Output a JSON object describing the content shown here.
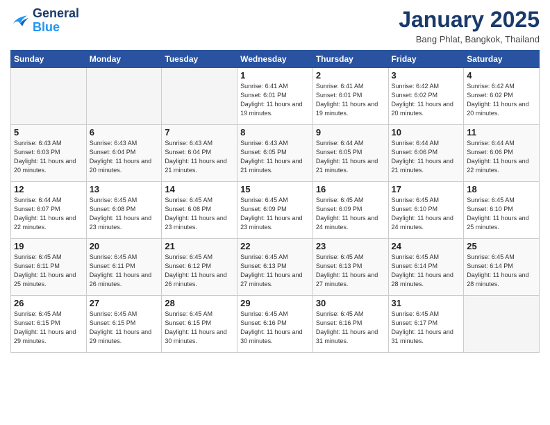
{
  "header": {
    "logo_line1": "General",
    "logo_line2": "Blue",
    "month": "January 2025",
    "location": "Bang Phlat, Bangkok, Thailand"
  },
  "days_of_week": [
    "Sunday",
    "Monday",
    "Tuesday",
    "Wednesday",
    "Thursday",
    "Friday",
    "Saturday"
  ],
  "weeks": [
    [
      {
        "num": "",
        "info": ""
      },
      {
        "num": "",
        "info": ""
      },
      {
        "num": "",
        "info": ""
      },
      {
        "num": "1",
        "info": "Sunrise: 6:41 AM\nSunset: 6:01 PM\nDaylight: 11 hours and 19 minutes."
      },
      {
        "num": "2",
        "info": "Sunrise: 6:41 AM\nSunset: 6:01 PM\nDaylight: 11 hours and 19 minutes."
      },
      {
        "num": "3",
        "info": "Sunrise: 6:42 AM\nSunset: 6:02 PM\nDaylight: 11 hours and 20 minutes."
      },
      {
        "num": "4",
        "info": "Sunrise: 6:42 AM\nSunset: 6:02 PM\nDaylight: 11 hours and 20 minutes."
      }
    ],
    [
      {
        "num": "5",
        "info": "Sunrise: 6:43 AM\nSunset: 6:03 PM\nDaylight: 11 hours and 20 minutes."
      },
      {
        "num": "6",
        "info": "Sunrise: 6:43 AM\nSunset: 6:04 PM\nDaylight: 11 hours and 20 minutes."
      },
      {
        "num": "7",
        "info": "Sunrise: 6:43 AM\nSunset: 6:04 PM\nDaylight: 11 hours and 21 minutes."
      },
      {
        "num": "8",
        "info": "Sunrise: 6:43 AM\nSunset: 6:05 PM\nDaylight: 11 hours and 21 minutes."
      },
      {
        "num": "9",
        "info": "Sunrise: 6:44 AM\nSunset: 6:05 PM\nDaylight: 11 hours and 21 minutes."
      },
      {
        "num": "10",
        "info": "Sunrise: 6:44 AM\nSunset: 6:06 PM\nDaylight: 11 hours and 21 minutes."
      },
      {
        "num": "11",
        "info": "Sunrise: 6:44 AM\nSunset: 6:06 PM\nDaylight: 11 hours and 22 minutes."
      }
    ],
    [
      {
        "num": "12",
        "info": "Sunrise: 6:44 AM\nSunset: 6:07 PM\nDaylight: 11 hours and 22 minutes."
      },
      {
        "num": "13",
        "info": "Sunrise: 6:45 AM\nSunset: 6:08 PM\nDaylight: 11 hours and 23 minutes."
      },
      {
        "num": "14",
        "info": "Sunrise: 6:45 AM\nSunset: 6:08 PM\nDaylight: 11 hours and 23 minutes."
      },
      {
        "num": "15",
        "info": "Sunrise: 6:45 AM\nSunset: 6:09 PM\nDaylight: 11 hours and 23 minutes."
      },
      {
        "num": "16",
        "info": "Sunrise: 6:45 AM\nSunset: 6:09 PM\nDaylight: 11 hours and 24 minutes."
      },
      {
        "num": "17",
        "info": "Sunrise: 6:45 AM\nSunset: 6:10 PM\nDaylight: 11 hours and 24 minutes."
      },
      {
        "num": "18",
        "info": "Sunrise: 6:45 AM\nSunset: 6:10 PM\nDaylight: 11 hours and 25 minutes."
      }
    ],
    [
      {
        "num": "19",
        "info": "Sunrise: 6:45 AM\nSunset: 6:11 PM\nDaylight: 11 hours and 25 minutes."
      },
      {
        "num": "20",
        "info": "Sunrise: 6:45 AM\nSunset: 6:11 PM\nDaylight: 11 hours and 26 minutes."
      },
      {
        "num": "21",
        "info": "Sunrise: 6:45 AM\nSunset: 6:12 PM\nDaylight: 11 hours and 26 minutes."
      },
      {
        "num": "22",
        "info": "Sunrise: 6:45 AM\nSunset: 6:13 PM\nDaylight: 11 hours and 27 minutes."
      },
      {
        "num": "23",
        "info": "Sunrise: 6:45 AM\nSunset: 6:13 PM\nDaylight: 11 hours and 27 minutes."
      },
      {
        "num": "24",
        "info": "Sunrise: 6:45 AM\nSunset: 6:14 PM\nDaylight: 11 hours and 28 minutes."
      },
      {
        "num": "25",
        "info": "Sunrise: 6:45 AM\nSunset: 6:14 PM\nDaylight: 11 hours and 28 minutes."
      }
    ],
    [
      {
        "num": "26",
        "info": "Sunrise: 6:45 AM\nSunset: 6:15 PM\nDaylight: 11 hours and 29 minutes."
      },
      {
        "num": "27",
        "info": "Sunrise: 6:45 AM\nSunset: 6:15 PM\nDaylight: 11 hours and 29 minutes."
      },
      {
        "num": "28",
        "info": "Sunrise: 6:45 AM\nSunset: 6:15 PM\nDaylight: 11 hours and 30 minutes."
      },
      {
        "num": "29",
        "info": "Sunrise: 6:45 AM\nSunset: 6:16 PM\nDaylight: 11 hours and 30 minutes."
      },
      {
        "num": "30",
        "info": "Sunrise: 6:45 AM\nSunset: 6:16 PM\nDaylight: 11 hours and 31 minutes."
      },
      {
        "num": "31",
        "info": "Sunrise: 6:45 AM\nSunset: 6:17 PM\nDaylight: 11 hours and 31 minutes."
      },
      {
        "num": "",
        "info": ""
      }
    ]
  ]
}
